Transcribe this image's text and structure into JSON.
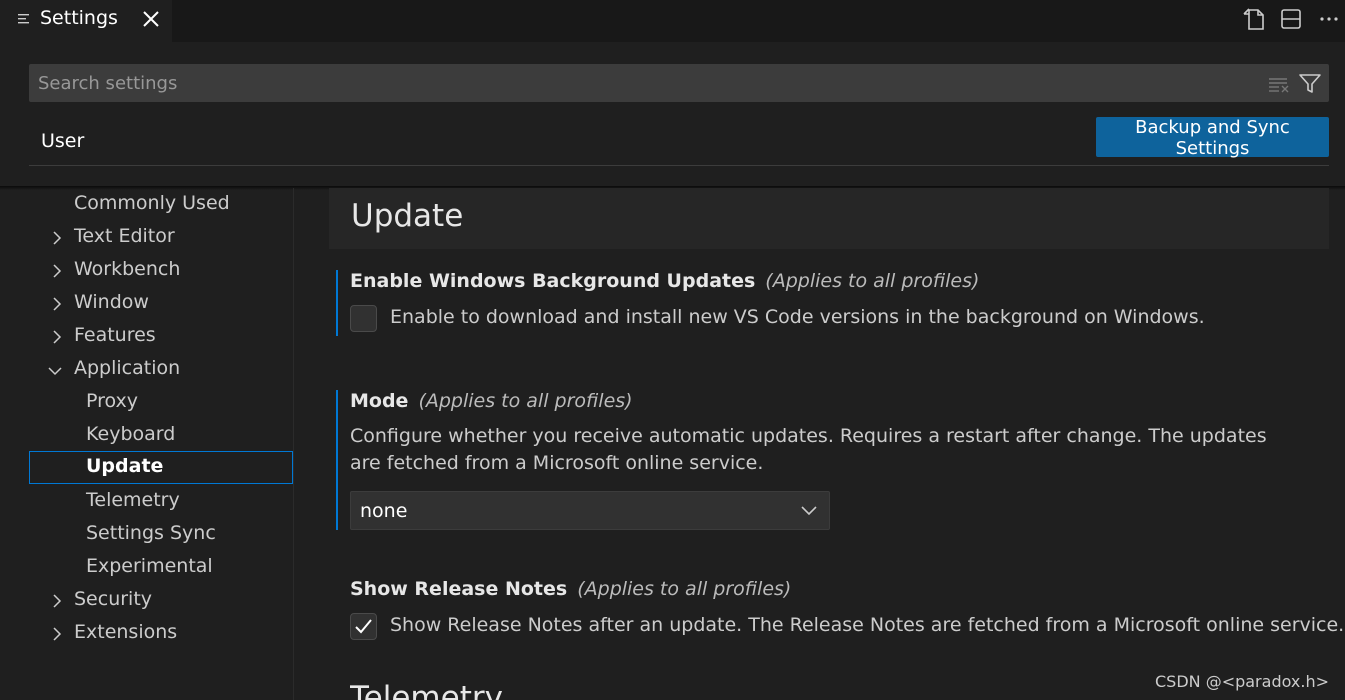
{
  "tab": {
    "title": "Settings",
    "icon": "settings-list-icon",
    "close_icon": "close-icon"
  },
  "toolbar": {
    "icons": [
      "open-settings-json-icon",
      "split-editor-icon",
      "more-actions-icon"
    ]
  },
  "search": {
    "placeholder": "Search settings",
    "value": ""
  },
  "scope": {
    "tabs": [
      {
        "label": "User",
        "active": true
      }
    ],
    "sync_button": "Backup and Sync Settings"
  },
  "toc": {
    "items": [
      {
        "label": "Commonly Used",
        "level": 0,
        "chevron": "none"
      },
      {
        "label": "Text Editor",
        "level": 0,
        "chevron": "right"
      },
      {
        "label": "Workbench",
        "level": 0,
        "chevron": "right"
      },
      {
        "label": "Window",
        "level": 0,
        "chevron": "right"
      },
      {
        "label": "Features",
        "level": 0,
        "chevron": "right"
      },
      {
        "label": "Application",
        "level": 0,
        "chevron": "down"
      },
      {
        "label": "Proxy",
        "level": 1,
        "chevron": "none"
      },
      {
        "label": "Keyboard",
        "level": 1,
        "chevron": "none"
      },
      {
        "label": "Update",
        "level": 1,
        "chevron": "none",
        "active": true
      },
      {
        "label": "Telemetry",
        "level": 1,
        "chevron": "none"
      },
      {
        "label": "Settings Sync",
        "level": 1,
        "chevron": "none"
      },
      {
        "label": "Experimental",
        "level": 1,
        "chevron": "none"
      },
      {
        "label": "Security",
        "level": 0,
        "chevron": "right"
      },
      {
        "label": "Extensions",
        "level": 0,
        "chevron": "right"
      }
    ]
  },
  "main": {
    "section_title": "Update",
    "next_section_title": "Telemetry",
    "settings": [
      {
        "title": "Enable Windows Background Updates",
        "scope_note": "(Applies to all profiles)",
        "checkbox_label": "Enable to download and install new VS Code versions in the background on Windows.",
        "checked": false
      },
      {
        "title": "Mode",
        "scope_note": "(Applies to all profiles)",
        "description": "Configure whether you receive automatic updates. Requires a restart after change. The updates are fetched from a Microsoft online service.",
        "select_value": "none"
      },
      {
        "title": "Show Release Notes",
        "scope_note": "(Applies to all profiles)",
        "checkbox_label": "Show Release Notes after an update. The Release Notes are fetched from a Microsoft online service.",
        "checked": true
      }
    ]
  },
  "watermark": "CSDN @<paradox.h>",
  "colors": {
    "accent": "#0078d4",
    "button": "#0e639c",
    "background": "#1f1f1f"
  }
}
